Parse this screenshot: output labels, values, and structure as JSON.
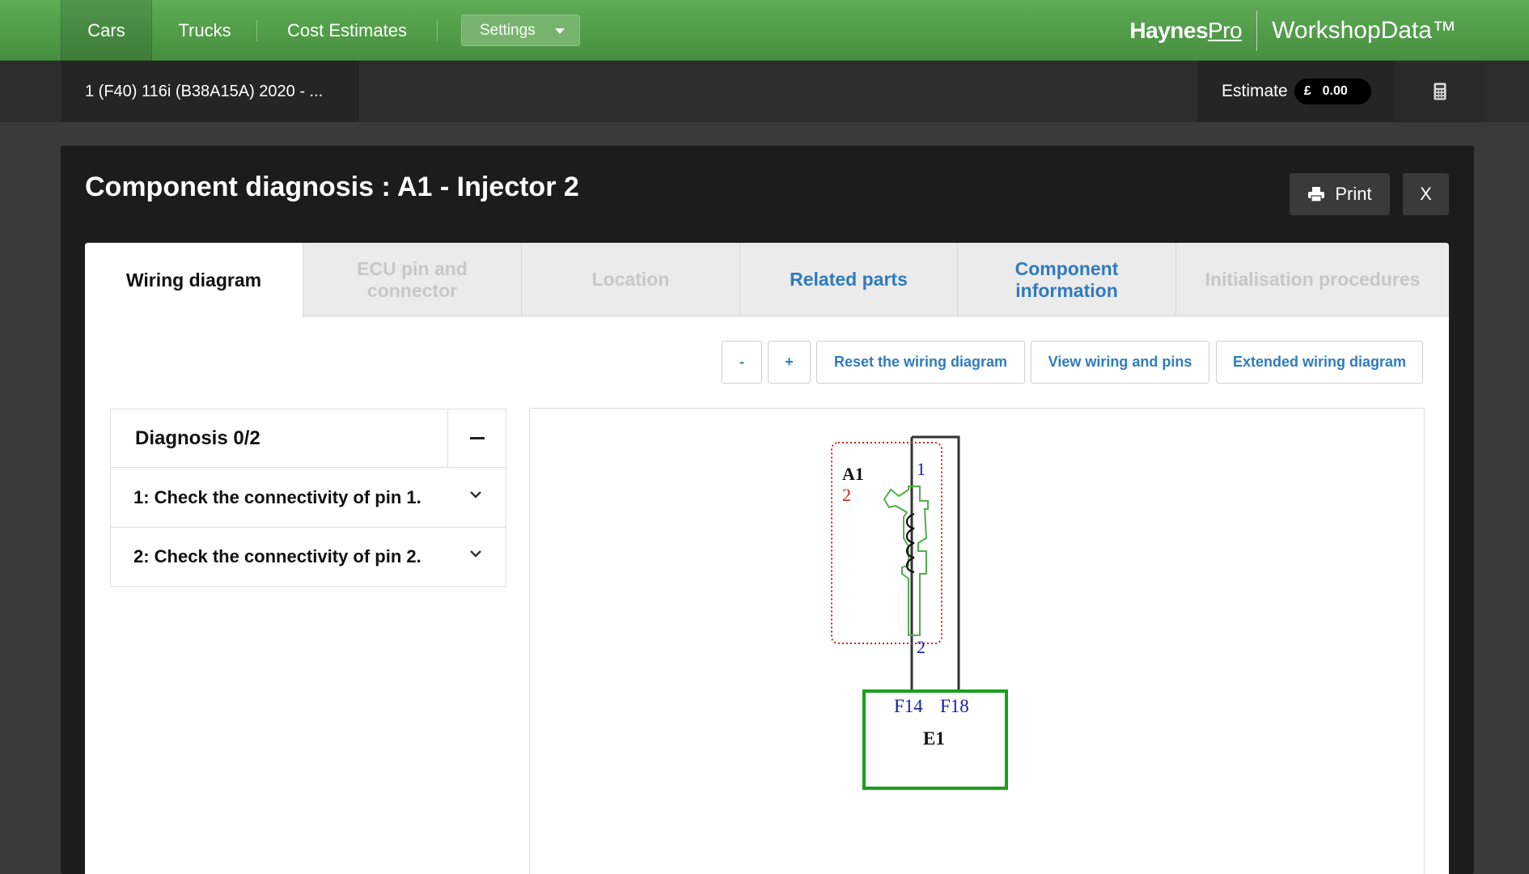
{
  "nav": {
    "cars": "Cars",
    "trucks": "Trucks",
    "cost_estimates": "Cost Estimates",
    "settings": "Settings",
    "brand_haynes": "Haynes",
    "brand_pro": "Pro",
    "brand_workshop": "WorkshopData™"
  },
  "subbar": {
    "vehicle": "1 (F40) 116i (B38A15A) 2020 - ...",
    "estimate_label": "Estimate",
    "currency": "£",
    "estimate_value": "0.00"
  },
  "modal": {
    "title": "Component diagnosis : A1 - Injector 2",
    "print": "Print",
    "close": "X"
  },
  "tabs": [
    {
      "label": "Wiring diagram",
      "state": "active"
    },
    {
      "label": "ECU pin and connector",
      "state": "disabled"
    },
    {
      "label": "Location",
      "state": "disabled"
    },
    {
      "label": "Related parts",
      "state": "link"
    },
    {
      "label": "Component information",
      "state": "link"
    },
    {
      "label": "Initialisation procedures",
      "state": "disabled"
    }
  ],
  "toolbar": {
    "zoom_out": "-",
    "zoom_in": "+",
    "reset": "Reset the wiring diagram",
    "view_pins": "View wiring and pins",
    "extended": "Extended wiring diagram"
  },
  "diagnosis": {
    "title": "Diagnosis 0/2",
    "items": [
      "1: Check the connectivity of pin 1.",
      "2: Check the connectivity of pin 2."
    ]
  },
  "diagram": {
    "component": "A1",
    "component_pin": "2",
    "pin_top": "1",
    "pin_bottom": "2",
    "ecu": "E1",
    "ecu_pin_left": "F14",
    "ecu_pin_right": "F18"
  },
  "colors": {
    "nav_green": "#52a04a",
    "link_blue": "#2f7bbf",
    "ecu_green": "#1aa01a",
    "dotted_red": "#d0201a",
    "pin_blue": "#1a1aa8"
  }
}
